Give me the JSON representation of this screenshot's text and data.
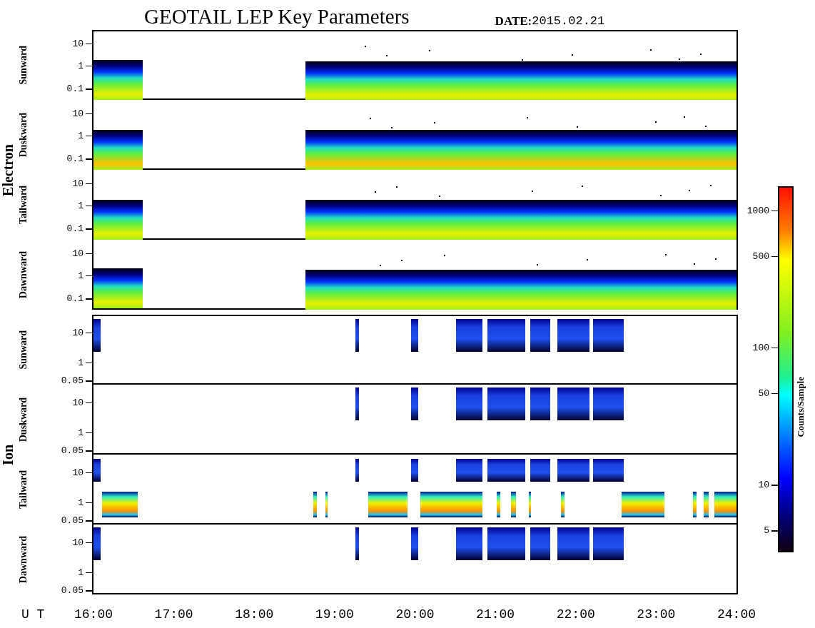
{
  "title": "GEOTAIL LEP Key Parameters",
  "date_label": "DATE:",
  "date": "2015.02.21",
  "groups": [
    {
      "label": "Electron",
      "kind": "electron",
      "panels": [
        {
          "label": "Sunward",
          "yticks": [
            "10",
            "1",
            "0.1"
          ]
        },
        {
          "label": "Duskward",
          "yticks": [
            "10",
            "1",
            "0.1"
          ]
        },
        {
          "label": "Tailward",
          "yticks": [
            "10",
            "1",
            "0.1"
          ]
        },
        {
          "label": "Dawnward",
          "yticks": [
            "10",
            "1",
            "0.1"
          ]
        }
      ]
    },
    {
      "label": "Ion",
      "kind": "ion",
      "panels": [
        {
          "label": "Sunward",
          "yticks": [
            "10",
            "1",
            "0.05"
          ]
        },
        {
          "label": "Duskward",
          "yticks": [
            "10",
            "1",
            "0.05"
          ]
        },
        {
          "label": "Tailward",
          "yticks": [
            "10",
            "1",
            "0.05"
          ]
        },
        {
          "label": "Dawnward",
          "yticks": [
            "10",
            "1",
            "0.05"
          ]
        }
      ]
    }
  ],
  "time_axis": {
    "label": "U T",
    "ticks": [
      "16:00",
      "17:00",
      "18:00",
      "19:00",
      "20:00",
      "21:00",
      "22:00",
      "23:00",
      "24:00"
    ]
  },
  "colorbar": {
    "label": "Counts/Sample",
    "ticks": [
      "1000",
      "500",
      "100",
      "50",
      "10",
      "5"
    ]
  }
}
